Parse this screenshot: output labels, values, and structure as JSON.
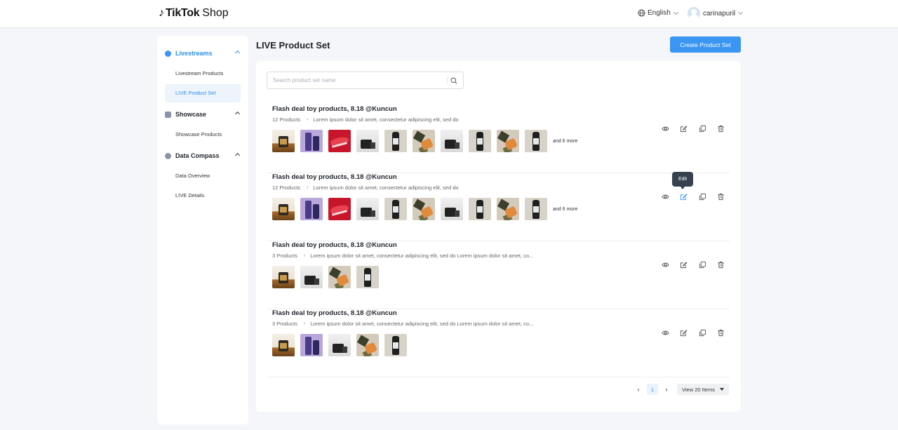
{
  "header": {
    "logo_brand": "TikTok",
    "logo_suffix": "Shop",
    "language": "English",
    "username": "carinapuril"
  },
  "sidebar": {
    "groups": [
      {
        "label": "Livestreams",
        "icon": "livestream-icon",
        "items": [
          "Livestream Products",
          "LIVE Product Set"
        ]
      },
      {
        "label": "Showcase",
        "icon": "showcase-icon",
        "items": [
          "Showcase Products"
        ]
      },
      {
        "label": "Data Compass",
        "icon": "compass-icon",
        "items": [
          "Data Overview",
          "LIVE Details"
        ]
      }
    ]
  },
  "page": {
    "title": "LIVE Product Set",
    "create_button": "Create Product Set",
    "search_placeholder": "Search product set name"
  },
  "product_sets": [
    {
      "title": "Flash deal toy products, 8.18 @Kuncun",
      "count": "12 Products",
      "description": "Lorem ipsum dolor sit amet, consectetur adipiscing elit, sed do",
      "thumbnails": [
        "bottle",
        "tube",
        "shoe",
        "camera",
        "serum",
        "flatlay",
        "camera",
        "serum",
        "flatlay",
        "serum"
      ],
      "more": "and 6 more"
    },
    {
      "title": "Flash deal toy products, 8.18 @Kuncun",
      "count": "12 Products",
      "description": "Lorem ipsum dolor sit amet, consectetur adipiscing elit, sed do",
      "thumbnails": [
        "bottle",
        "tube",
        "shoe",
        "camera",
        "serum",
        "flatlay",
        "camera",
        "serum",
        "flatlay",
        "serum"
      ],
      "more": "and 6 more"
    },
    {
      "title": "Flash deal toy products, 8.18 @Kuncun",
      "count": "3 Products",
      "description": "Lorem ipsum dolor sit amet, consectetur adipiscing elit, sed do Lorem ipsum dolor sit amet, co...",
      "thumbnails": [
        "bottle",
        "camera",
        "flatlay",
        "serum"
      ],
      "more": ""
    },
    {
      "title": "Flash deal toy products, 8.18 @Kuncun",
      "count": "3 Products",
      "description": "Lorem ipsum dolor sit amet, consectetur adipiscing elit, sed do Lorem ipsum dolor sit amet, co...",
      "thumbnails": [
        "bottle",
        "tube",
        "camera",
        "flatlay",
        "serum"
      ],
      "more": ""
    }
  ],
  "tooltip": "Edit",
  "pagination": {
    "prev": "‹",
    "current_page": "1",
    "next": "›",
    "page_size": "View 20 Items"
  },
  "colors": {
    "accent": "#3a95f3",
    "active_text": "#2a8ef0"
  }
}
